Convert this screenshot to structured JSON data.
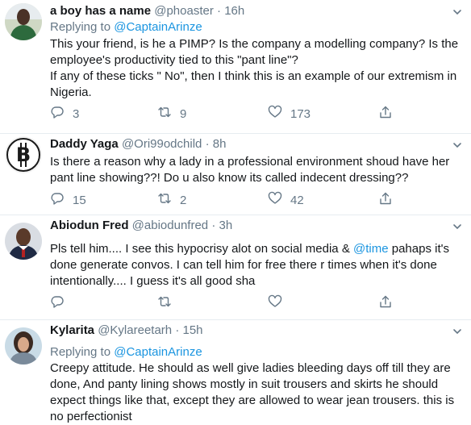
{
  "tweets": [
    {
      "name": "a boy has a name",
      "handle": "@phoaster",
      "time": "16h",
      "reply_prefix": "Replying to",
      "reply_to": "@CaptainArinze",
      "body_lines": [
        "This your friend, is he a PIMP? Is the company a modelling company? Is the",
        "employee's productivity tied to this \"pant line\"?",
        "If any of these ticks \" No\", then I think this is an example of our extremism in",
        "Nigeria."
      ],
      "replies": "3",
      "retweets": "9",
      "likes": "173"
    },
    {
      "name": "Daddy Yaga",
      "handle": "@Ori99odchild",
      "time": "8h",
      "body_lines": [
        "Is there a reason why a lady in a professional environment shoud have her",
        "pant line showing??!  Do u also know its called indecent dressing??"
      ],
      "replies": "15",
      "retweets": "2",
      "likes": "42"
    },
    {
      "name": "Abiodun Fred",
      "handle": "@abiodunfred",
      "time": "3h",
      "body_line1_a": "Pls tell him.... I see this hypocrisy alot on social media & ",
      "body_line1_mention": "@time",
      "body_line1_b": " pahaps it's",
      "body_lines": [
        "done generate convos. I can tell him for free there r times when it's done",
        "intentionally.... I guess it's all good sha"
      ],
      "replies": "",
      "retweets": "",
      "likes": ""
    },
    {
      "name": "Kylarita",
      "handle": "@Kylareetarh",
      "time": "15h",
      "reply_prefix": "Replying to",
      "reply_to": "@CaptainArinze",
      "body_lines": [
        "Creepy attitude. He should as well give ladies bleeding days off till they are",
        "done, And panty lining shows mostly in suit trousers and skirts he should",
        "expect things like that, except they are allowed to wear jean trousers. this is",
        "no perfectionist"
      ]
    }
  ],
  "dot": "·",
  "colors": {
    "text": "#14171a",
    "secondary": "#657786",
    "link": "#1b95e0",
    "border": "#e6ecf0"
  },
  "icons": [
    "reply-icon",
    "retweet-icon",
    "like-icon",
    "share-icon",
    "caret-down-icon",
    "bitcoin-icon"
  ]
}
